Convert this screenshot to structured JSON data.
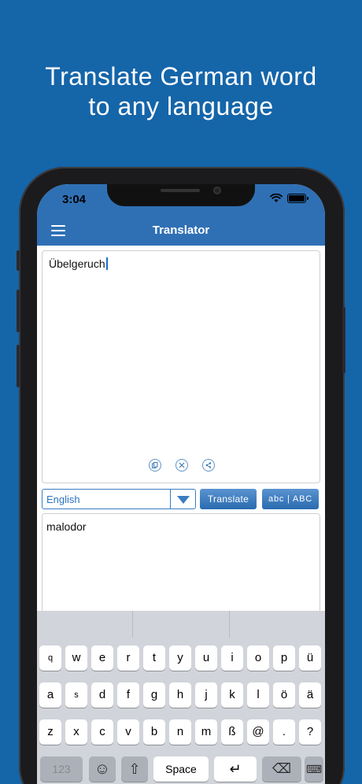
{
  "headline": {
    "line1": "Translate German word",
    "line2": "to any language"
  },
  "status": {
    "time": "3:04"
  },
  "nav": {
    "title": "Translator"
  },
  "input": {
    "text": "Übelgeruch"
  },
  "controls": {
    "language": "English",
    "translate_label": "Translate",
    "case_label": "abc | ABC"
  },
  "output": {
    "text": "malodor"
  },
  "icons": {
    "copy": "copy-icon",
    "clear": "clear-icon",
    "share": "share-icon"
  },
  "colors": {
    "background": "#1565a9",
    "nav": "#2f70b5",
    "accent": "#3a7cc1"
  },
  "keyboard": {
    "row1": [
      "q",
      "w",
      "e",
      "r",
      "t",
      "y",
      "u",
      "i",
      "o",
      "p",
      "ü"
    ],
    "row2": [
      "a",
      "s",
      "d",
      "f",
      "g",
      "h",
      "j",
      "k",
      "l",
      "ö",
      "ä"
    ],
    "row3": [
      "z",
      "x",
      "c",
      "v",
      "b",
      "n",
      "m",
      "ß",
      "@",
      ".",
      "?"
    ],
    "numbers_label": "123",
    "space_label": "Space",
    "emoji_glyph": "☺",
    "shift_glyph": "⇧",
    "return_glyph": "↵",
    "delete_glyph": "⌫",
    "keyboard_glyph": "⌨"
  }
}
